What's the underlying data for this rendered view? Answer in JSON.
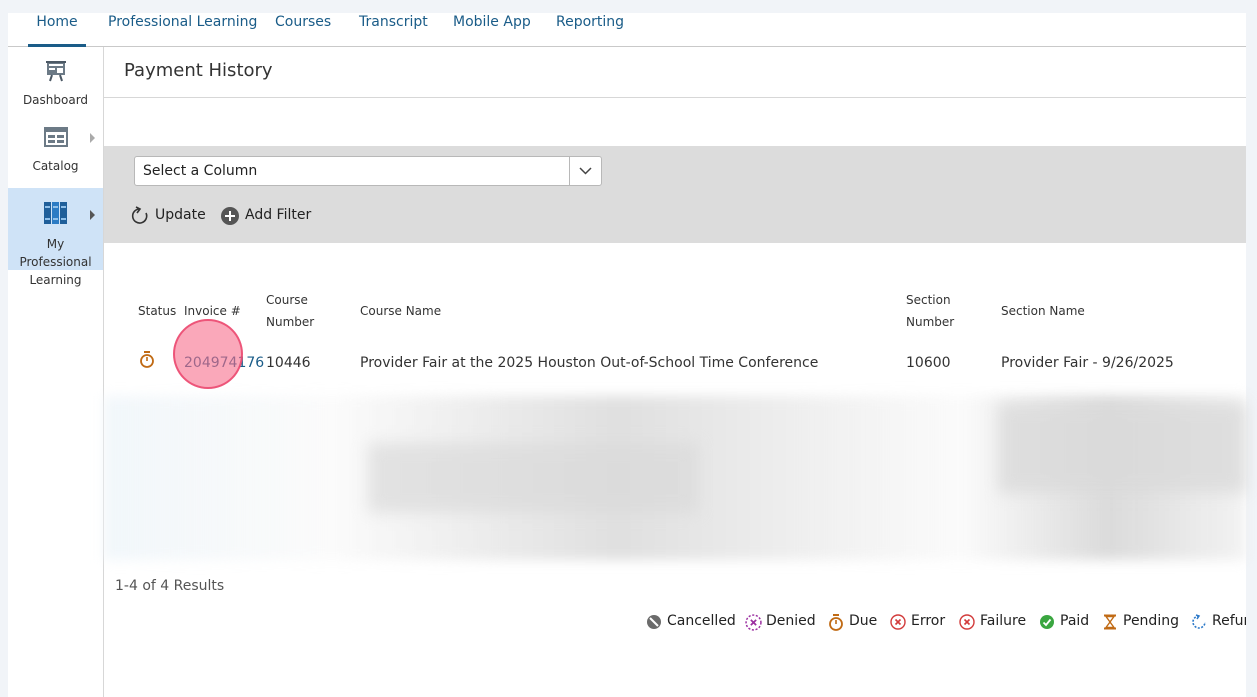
{
  "nav": {
    "tabs": [
      {
        "label": "Home",
        "active": true
      },
      {
        "label": "Professional Learning"
      },
      {
        "label": "Courses"
      },
      {
        "label": "Transcript"
      },
      {
        "label": "Mobile App"
      },
      {
        "label": "Reporting"
      }
    ]
  },
  "sidebar": {
    "items": [
      {
        "label": "Dashboard",
        "icon": "dashboard-icon"
      },
      {
        "label": "Catalog",
        "icon": "catalog-icon"
      },
      {
        "label": "My Professional Learning",
        "icon": "books-icon",
        "active": true
      }
    ]
  },
  "page": {
    "title": "Payment History"
  },
  "filter": {
    "select_value": "Select a Column",
    "update_label": "Update",
    "add_filter_label": "Add Filter"
  },
  "table": {
    "headers": {
      "status": "Status",
      "invoice": "Invoice #",
      "course_number_1": "Course",
      "course_number_2": "Number",
      "course_name": "Course Name",
      "section_number_1": "Section",
      "section_number_2": "Number",
      "section_name": "Section Name"
    },
    "rows": [
      {
        "status": "Due",
        "invoice": "204974176",
        "course_number": "10446",
        "course_name": "Provider Fair at the 2025 Houston Out-of-School Time Conference",
        "section_number": "10600",
        "section_name": "Provider Fair - 9/26/2025"
      }
    ]
  },
  "results": {
    "summary": "1-4 of 4 Results"
  },
  "legend": {
    "items": [
      "Cancelled",
      "Denied",
      "Due",
      "Error",
      "Failure",
      "Paid",
      "Pending",
      "Refur"
    ]
  },
  "colors": {
    "link": "#1a5c88",
    "due": "#c06a14",
    "denied": "#9b2fa0",
    "error": "#d23a3a",
    "paid": "#3aa640",
    "cancelled": "#6b6b6b",
    "pending": "#c06a14",
    "refund": "#2a78c8"
  }
}
